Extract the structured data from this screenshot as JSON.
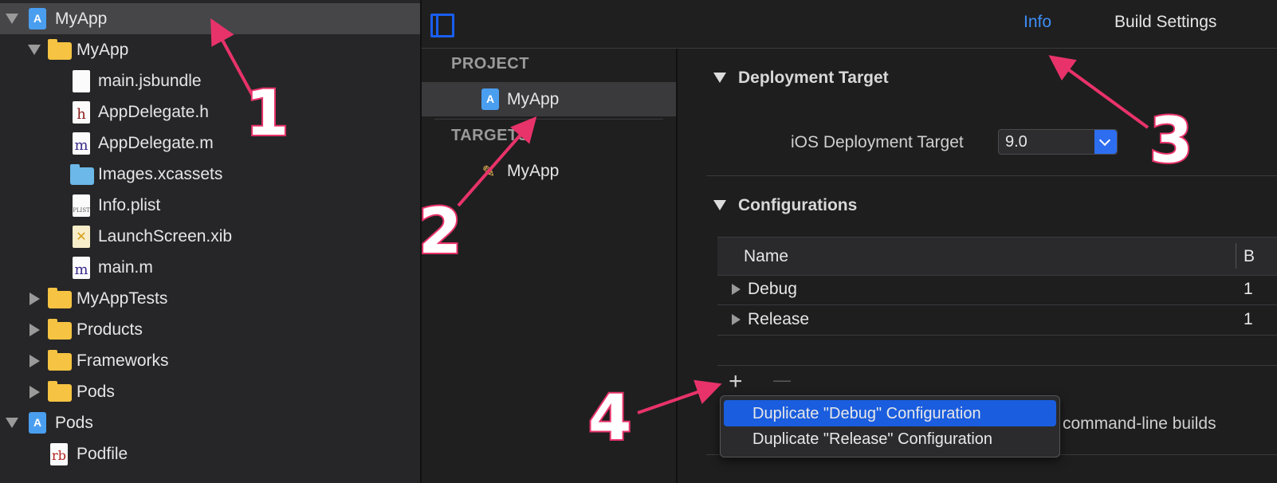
{
  "navigator": {
    "items": [
      {
        "label": "MyApp",
        "kind": "project",
        "expanded": true
      },
      {
        "label": "MyApp",
        "kind": "folder",
        "expanded": true
      },
      {
        "label": "main.jsbundle",
        "kind": "file"
      },
      {
        "label": "AppDelegate.h",
        "kind": "header-file",
        "glyph": "h"
      },
      {
        "label": "AppDelegate.m",
        "kind": "source-file",
        "glyph": "m"
      },
      {
        "label": "Images.xcassets",
        "kind": "asset-folder"
      },
      {
        "label": "Info.plist",
        "kind": "plist-file",
        "glyph": "PLIST"
      },
      {
        "label": "LaunchScreen.xib",
        "kind": "xib-file",
        "glyph": "✕"
      },
      {
        "label": "main.m",
        "kind": "source-file",
        "glyph": "m"
      },
      {
        "label": "MyAppTests",
        "kind": "folder",
        "expanded": false
      },
      {
        "label": "Products",
        "kind": "folder",
        "expanded": false
      },
      {
        "label": "Frameworks",
        "kind": "folder",
        "expanded": false
      },
      {
        "label": "Pods",
        "kind": "folder",
        "expanded": false
      },
      {
        "label": "Pods",
        "kind": "project",
        "expanded": true
      },
      {
        "label": "Podfile",
        "kind": "ruby-file",
        "glyph": "rb"
      }
    ]
  },
  "tabs": {
    "info": "Info",
    "build_settings": "Build Settings"
  },
  "editor_list": {
    "project_header": "PROJECT",
    "project_item": "MyApp",
    "targets_header": "TARGETS",
    "target_item": "MyApp"
  },
  "deployment": {
    "section": "Deployment Target",
    "field_label": "iOS Deployment Target",
    "value": "9.0"
  },
  "configurations": {
    "section": "Configurations",
    "column_name": "Name",
    "column_next_partial": "B",
    "rows": [
      {
        "name": "Debug",
        "trailing": "1"
      },
      {
        "name": "Release",
        "trailing": "1"
      }
    ],
    "add_symbol": "+",
    "remove_symbol": "—"
  },
  "menu": {
    "items": [
      "Duplicate \"Debug\" Configuration",
      "Duplicate \"Release\" Configuration"
    ]
  },
  "trailing_text": "command-line builds",
  "annotations": [
    "1",
    "2",
    "3",
    "4"
  ],
  "colors": {
    "accent": "#3d8ef5",
    "highlight": "#1a5dde",
    "annotation": "#e8336a"
  }
}
